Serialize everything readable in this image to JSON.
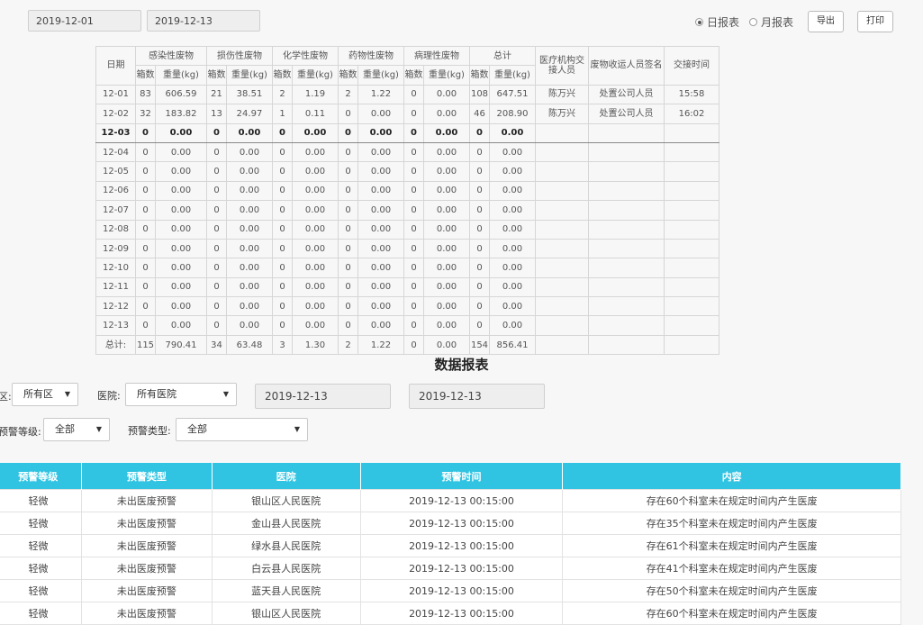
{
  "top": {
    "start_date": "2019-12-01",
    "end_date": "2019-12-13",
    "radio_daily": "日报表",
    "radio_monthly": "月报表",
    "export_label": "导出",
    "print_label": "打印"
  },
  "report": {
    "col_date": "日期",
    "groups": [
      "感染性废物",
      "损伤性废物",
      "化学性废物",
      "药物性废物",
      "病理性废物",
      "总计"
    ],
    "sub_count": "箱数",
    "sub_weight": "重量(kg)",
    "col_handover": "医疗机构交接人员",
    "col_signer": "废物收运人员签名",
    "col_time": "交接时间",
    "rows": [
      [
        "12-01",
        "83",
        "606.59",
        "21",
        "38.51",
        "2",
        "1.19",
        "2",
        "1.22",
        "0",
        "0.00",
        "108",
        "647.51",
        "陈万兴",
        "处置公司人员",
        "15:58"
      ],
      [
        "12-02",
        "32",
        "183.82",
        "13",
        "24.97",
        "1",
        "0.11",
        "0",
        "0.00",
        "0",
        "0.00",
        "46",
        "208.90",
        "陈万兴",
        "处置公司人员",
        "16:02"
      ],
      [
        "12-03",
        "0",
        "0.00",
        "0",
        "0.00",
        "0",
        "0.00",
        "0",
        "0.00",
        "0",
        "0.00",
        "0",
        "0.00",
        "",
        "",
        ""
      ],
      [
        "12-04",
        "0",
        "0.00",
        "0",
        "0.00",
        "0",
        "0.00",
        "0",
        "0.00",
        "0",
        "0.00",
        "0",
        "0.00",
        "",
        "",
        ""
      ],
      [
        "12-05",
        "0",
        "0.00",
        "0",
        "0.00",
        "0",
        "0.00",
        "0",
        "0.00",
        "0",
        "0.00",
        "0",
        "0.00",
        "",
        "",
        ""
      ],
      [
        "12-06",
        "0",
        "0.00",
        "0",
        "0.00",
        "0",
        "0.00",
        "0",
        "0.00",
        "0",
        "0.00",
        "0",
        "0.00",
        "",
        "",
        ""
      ],
      [
        "12-07",
        "0",
        "0.00",
        "0",
        "0.00",
        "0",
        "0.00",
        "0",
        "0.00",
        "0",
        "0.00",
        "0",
        "0.00",
        "",
        "",
        ""
      ],
      [
        "12-08",
        "0",
        "0.00",
        "0",
        "0.00",
        "0",
        "0.00",
        "0",
        "0.00",
        "0",
        "0.00",
        "0",
        "0.00",
        "",
        "",
        ""
      ],
      [
        "12-09",
        "0",
        "0.00",
        "0",
        "0.00",
        "0",
        "0.00",
        "0",
        "0.00",
        "0",
        "0.00",
        "0",
        "0.00",
        "",
        "",
        ""
      ],
      [
        "12-10",
        "0",
        "0.00",
        "0",
        "0.00",
        "0",
        "0.00",
        "0",
        "0.00",
        "0",
        "0.00",
        "0",
        "0.00",
        "",
        "",
        ""
      ],
      [
        "12-11",
        "0",
        "0.00",
        "0",
        "0.00",
        "0",
        "0.00",
        "0",
        "0.00",
        "0",
        "0.00",
        "0",
        "0.00",
        "",
        "",
        ""
      ],
      [
        "12-12",
        "0",
        "0.00",
        "0",
        "0.00",
        "0",
        "0.00",
        "0",
        "0.00",
        "0",
        "0.00",
        "0",
        "0.00",
        "",
        "",
        ""
      ],
      [
        "12-13",
        "0",
        "0.00",
        "0",
        "0.00",
        "0",
        "0.00",
        "0",
        "0.00",
        "0",
        "0.00",
        "0",
        "0.00",
        "",
        "",
        ""
      ],
      [
        "总计:",
        "115",
        "790.41",
        "34",
        "63.48",
        "3",
        "1.30",
        "2",
        "1.22",
        "0",
        "0.00",
        "154",
        "856.41",
        "",
        "",
        ""
      ]
    ],
    "selected_row": 2
  },
  "section_title": "数据报表",
  "filters": {
    "district_label": "区:",
    "district_value": "所有区",
    "hospital_label": "医院:",
    "hospital_value": "所有医院",
    "start_date": "2019-12-13",
    "end_date": "2019-12-13",
    "level_label": "预警等级:",
    "level_value": "全部",
    "type_label": "预警类型:",
    "type_value": "全部"
  },
  "alerts": {
    "headers": [
      "预警等级",
      "预警类型",
      "医院",
      "预警时间",
      "内容"
    ],
    "rows": [
      [
        "轻微",
        "未出医废预警",
        "银山区人民医院",
        "2019-12-13 00:15:00",
        "存在60个科室未在规定时间内产生医废"
      ],
      [
        "轻微",
        "未出医废预警",
        "金山县人民医院",
        "2019-12-13 00:15:00",
        "存在35个科室未在规定时间内产生医废"
      ],
      [
        "轻微",
        "未出医废预警",
        "绿水县人民医院",
        "2019-12-13 00:15:00",
        "存在61个科室未在规定时间内产生医废"
      ],
      [
        "轻微",
        "未出医废预警",
        "白云县人民医院",
        "2019-12-13 00:15:00",
        "存在41个科室未在规定时间内产生医废"
      ],
      [
        "轻微",
        "未出医废预警",
        "蓝天县人民医院",
        "2019-12-13 00:15:00",
        "存在50个科室未在规定时间内产生医废"
      ],
      [
        "轻微",
        "未出医废预警",
        "银山区人民医院",
        "2019-12-13 00:15:00",
        "存在60个科室未在规定时间内产生医废"
      ]
    ]
  },
  "colors": {
    "header_bg": "#31c4e2"
  }
}
